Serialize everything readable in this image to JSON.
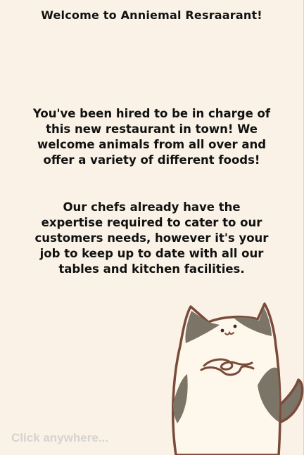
{
  "title": "Welcome to Anniemal Resraarant!",
  "intro": {
    "lines": [
      "You've been hired to be in charge of",
      "this new restaurant in town! We",
      "welcome animals from all over and",
      "offer a variety of different foods!"
    ]
  },
  "details": {
    "lines": [
      "Our chefs already have the",
      "expertise required to cater to our",
      "customers needs, however it's your",
      "job to keep up to date with all our",
      "tables and kitchen facilities."
    ]
  },
  "hint": "Click anywhere...",
  "colors": {
    "background": "#faf2e6",
    "text": "#111111",
    "hint": "#d6d3cf",
    "cat_fur": "#fdf7ec",
    "cat_outline": "#7a4a3a",
    "cat_patches": "#7d7468"
  },
  "illustration": "cat-mascot-icon"
}
